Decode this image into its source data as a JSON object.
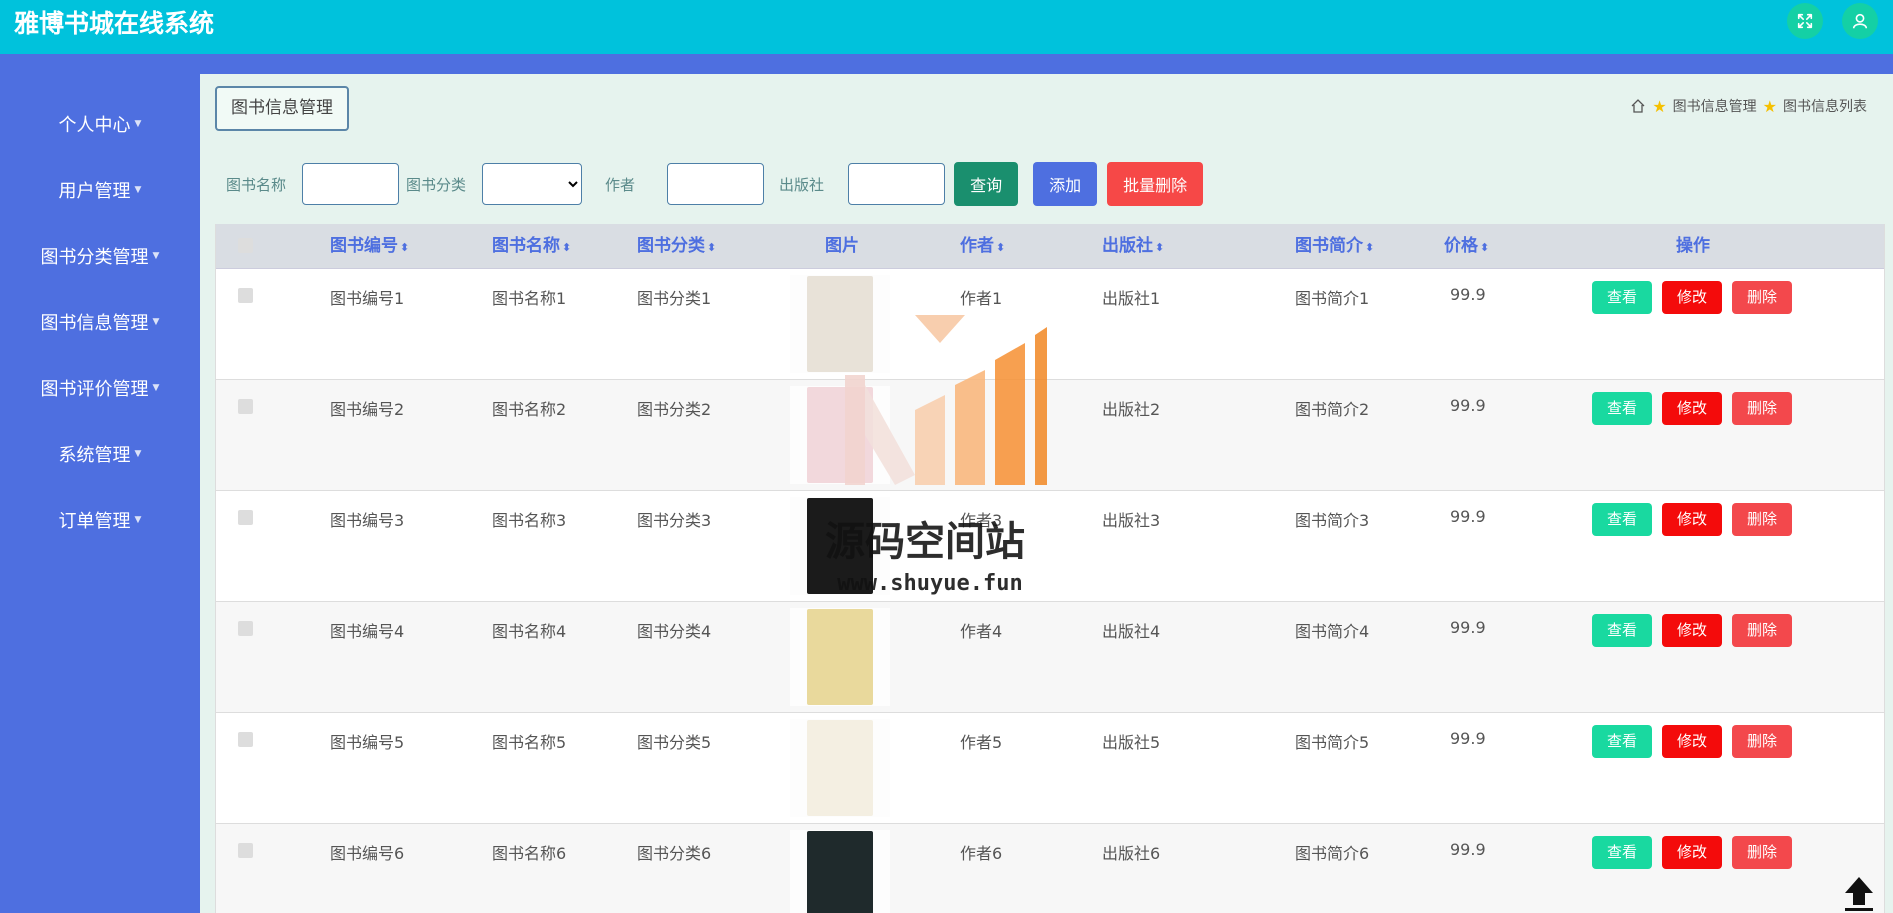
{
  "app": {
    "title": "雅博书城在线系统"
  },
  "header_icons": [
    {
      "name": "fullscreen-icon"
    },
    {
      "name": "user-icon"
    }
  ],
  "sidebar": {
    "items": [
      {
        "label": "个人中心"
      },
      {
        "label": "用户管理"
      },
      {
        "label": "图书分类管理"
      },
      {
        "label": "图书信息管理"
      },
      {
        "label": "图书评价管理"
      },
      {
        "label": "系统管理"
      },
      {
        "label": "订单管理"
      }
    ]
  },
  "page": {
    "tag": "图书信息管理",
    "breadcrumb": [
      "图书信息管理",
      "图书信息列表"
    ]
  },
  "search": {
    "name_label": "图书名称",
    "name_value": "",
    "category_label": "图书分类",
    "category_value": "",
    "author_label": "作者",
    "author_value": "",
    "publisher_label": "出版社",
    "publisher_value": "",
    "query_button": "查询",
    "add_button": "添加",
    "batch_delete_button": "批量删除"
  },
  "table": {
    "columns": [
      "图书编号",
      "图书名称",
      "图书分类",
      "图片",
      "作者",
      "出版社",
      "图书简介",
      "价格",
      "操作"
    ],
    "actions": {
      "view": "查看",
      "edit": "修改",
      "delete": "删除"
    },
    "rows": [
      {
        "id": "图书编号1",
        "name": "图书名称1",
        "category": "图书分类1",
        "author": "作者1",
        "publisher": "出版社1",
        "intro": "图书简介1",
        "price": "99.9",
        "cover_color": "#e8e2d8"
      },
      {
        "id": "图书编号2",
        "name": "图书名称2",
        "category": "图书分类2",
        "author": "",
        "publisher": "出版社2",
        "intro": "图书简介2",
        "price": "99.9",
        "cover_color": "#f2d8dc"
      },
      {
        "id": "图书编号3",
        "name": "图书名称3",
        "category": "图书分类3",
        "author": "作者3",
        "publisher": "出版社3",
        "intro": "图书简介3",
        "price": "99.9",
        "cover_color": "#1b1b1b"
      },
      {
        "id": "图书编号4",
        "name": "图书名称4",
        "category": "图书分类4",
        "author": "作者4",
        "publisher": "出版社4",
        "intro": "图书简介4",
        "price": "99.9",
        "cover_color": "#e9d99c"
      },
      {
        "id": "图书编号5",
        "name": "图书名称5",
        "category": "图书分类5",
        "author": "作者5",
        "publisher": "出版社5",
        "intro": "图书简介5",
        "price": "99.9",
        "cover_color": "#f4efe2"
      },
      {
        "id": "图书编号6",
        "name": "图书名称6",
        "category": "图书分类6",
        "author": "作者6",
        "publisher": "出版社6",
        "intro": "图书简介6",
        "price": "99.9",
        "cover_color": "#1f2a2c"
      }
    ]
  },
  "watermark": {
    "line1": "源码空间站",
    "line2": "www.shuyue.fun"
  }
}
